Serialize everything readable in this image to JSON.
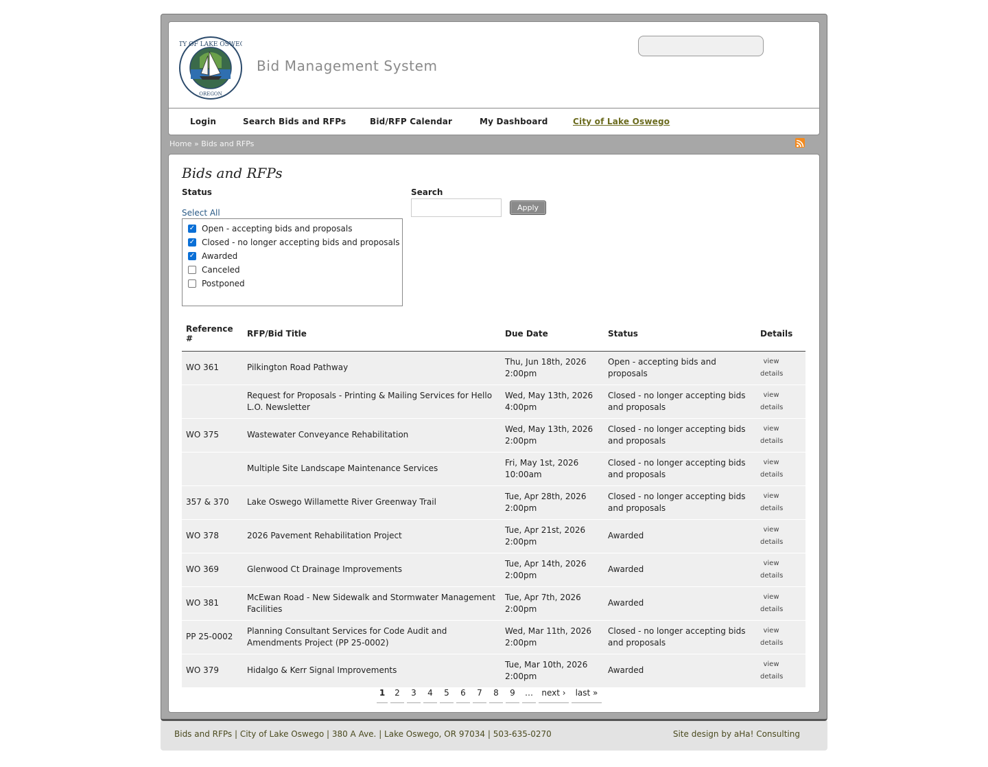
{
  "header": {
    "site_name": "Bid Management System",
    "logo_text_top": "CITY OF LAKE OSWEGO",
    "logo_text_bottom": "OREGON"
  },
  "nav": {
    "items": [
      "Login",
      "Search Bids and RFPs",
      "Bid/RFP Calendar",
      "My Dashboard",
      "City of Lake Oswego"
    ]
  },
  "breadcrumb": {
    "home": "Home",
    "separator": "»",
    "current": "Bids and RFPs"
  },
  "page": {
    "title": "Bids and RFPs",
    "status_label": "Status",
    "select_all": "Select All",
    "search_label": "Search",
    "search_value": "",
    "apply_label": "Apply",
    "status_options": [
      {
        "label": "Open - accepting bids and proposals",
        "checked": true
      },
      {
        "label": "Closed - no longer accepting bids and proposals",
        "checked": true
      },
      {
        "label": "Awarded",
        "checked": true
      },
      {
        "label": "Canceled",
        "checked": false
      },
      {
        "label": "Postponed",
        "checked": false
      }
    ]
  },
  "table": {
    "headers": [
      "Reference #",
      "RFP/Bid Title",
      "Due Date",
      "Status",
      "Details"
    ],
    "rows": [
      {
        "ref": "WO 361",
        "title": "Pilkington Road Pathway",
        "due1": "Thu, Jun 18th, 2026",
        "due2": "2:00pm",
        "status": "Open - accepting bids and proposals"
      },
      {
        "ref": "",
        "title": "Request for Proposals - Printing & Mailing Services for Hello L.O. Newsletter",
        "due1": "Wed, May 13th, 2026",
        "due2": "4:00pm",
        "status": "Closed - no longer accepting bids and proposals"
      },
      {
        "ref": "WO 375",
        "title": "Wastewater Conveyance Rehabilitation",
        "due1": "Wed, May 13th, 2026",
        "due2": "2:00pm",
        "status": "Closed - no longer accepting bids and proposals"
      },
      {
        "ref": "",
        "title": "Multiple Site Landscape Maintenance Services",
        "due1": "Fri, May 1st, 2026",
        "due2": "10:00am",
        "status": "Closed - no longer accepting bids and proposals"
      },
      {
        "ref": "357 & 370",
        "title": "Lake Oswego Willamette River Greenway Trail",
        "due1": "Tue, Apr 28th, 2026",
        "due2": "2:00pm",
        "status": "Closed - no longer accepting bids and proposals"
      },
      {
        "ref": "WO 378",
        "title": "2026 Pavement Rehabilitation Project",
        "due1": "Tue, Apr 21st, 2026",
        "due2": "2:00pm",
        "status": "Awarded"
      },
      {
        "ref": "WO 369",
        "title": "Glenwood Ct Drainage Improvements",
        "due1": "Tue, Apr 14th, 2026",
        "due2": "2:00pm",
        "status": "Awarded"
      },
      {
        "ref": "WO 381",
        "title": "McEwan Road - New Sidewalk and Stormwater Management Facilities",
        "due1": "Tue, Apr 7th, 2026",
        "due2": "2:00pm",
        "status": "Awarded"
      },
      {
        "ref": "PP 25-0002",
        "title": "Planning Consultant Services for Code Audit and Amendments Project (PP 25-0002)",
        "due1": "Wed, Mar 11th, 2026",
        "due2": "2:00pm",
        "status": "Closed - no longer accepting bids and proposals"
      },
      {
        "ref": "WO 379",
        "title": "Hidalgo & Kerr Signal Improvements",
        "due1": "Tue, Mar 10th, 2026",
        "due2": "2:00pm",
        "status": "Awarded"
      }
    ],
    "details_line1": "view",
    "details_line2": "details"
  },
  "pager": {
    "items": [
      "1",
      "2",
      "3",
      "4",
      "5",
      "6",
      "7",
      "8",
      "9",
      "…",
      "next ›",
      "last »"
    ],
    "current": "1"
  },
  "footer": {
    "left": "Bids and RFPs | City of Lake Oswego | 380 A Ave. | Lake Oswego, OR 97034 | 503-635-0270",
    "right": "Site design by aHa! Consulting"
  },
  "colors": {
    "frame": "#a7a7a7",
    "link_olive": "#6b6b1e",
    "checkbox": "#0a6fd6",
    "row_bg": "#efefef"
  }
}
